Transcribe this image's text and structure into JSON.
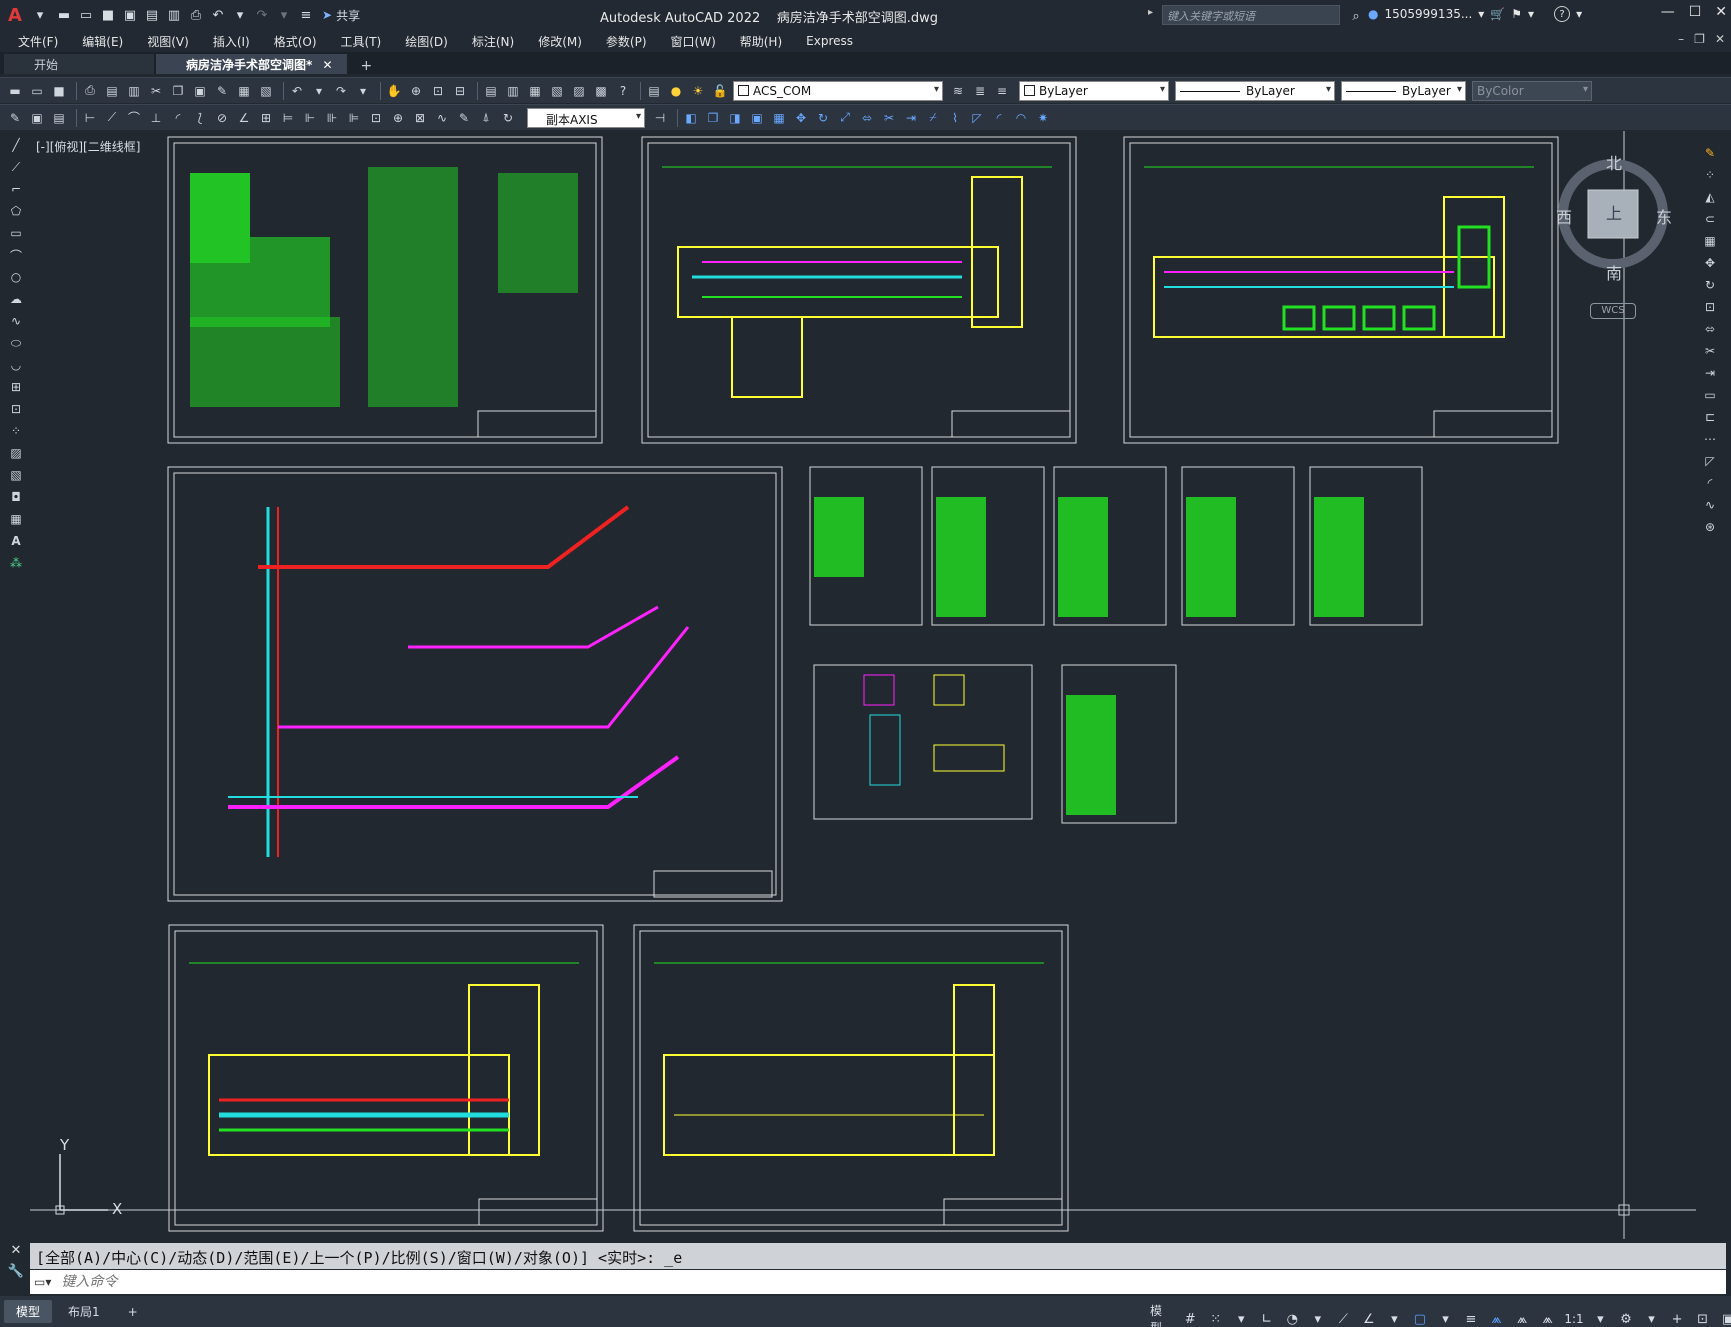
{
  "app": {
    "title": "Autodesk AutoCAD 2022",
    "document": "病房洁净手术部空调图.dwg",
    "share_label": "共享",
    "search_placeholder": "键入关键字或短语",
    "user": "1505999135...",
    "help": "?"
  },
  "menu": [
    "文件(F)",
    "编辑(E)",
    "视图(V)",
    "插入(I)",
    "格式(O)",
    "工具(T)",
    "绘图(D)",
    "标注(N)",
    "修改(M)",
    "参数(P)",
    "窗口(W)",
    "帮助(H)",
    "Express"
  ],
  "tabs": [
    {
      "label": "开始",
      "active": false
    },
    {
      "label": "病房洁净手术部空调图*",
      "active": true
    }
  ],
  "toolbar": {
    "layer": "ACS_COM",
    "color": "ByLayer",
    "linetype": "ByLayer",
    "lineweight": "ByLayer",
    "plotstyle": "ByColor",
    "dimstyle": "副本AXIS"
  },
  "viewport": {
    "label": "[-][俯视][二维线框]"
  },
  "viewcube": {
    "north": "北",
    "south": "南",
    "east": "东",
    "west": "西",
    "top": "上",
    "wcs": "WCS"
  },
  "ucs": {
    "x": "X",
    "y": "Y"
  },
  "command": {
    "history": "[全部(A)/中心(C)/动态(D)/范围(E)/上一个(P)/比例(S)/窗口(W)/对象(O)] <实时>: _e",
    "placeholder": "键入命令"
  },
  "status": {
    "layouts": [
      {
        "label": "模型",
        "active": true
      },
      {
        "label": "布局1",
        "active": false
      }
    ],
    "model": "模型",
    "scale": "1:1"
  },
  "colors": {
    "background": "#212830",
    "accent": "#e03a3a",
    "green": "#22e022",
    "yellow": "#ffff33",
    "cyan": "#22dddd",
    "magenta": "#ff22ff",
    "red": "#ee2222"
  }
}
